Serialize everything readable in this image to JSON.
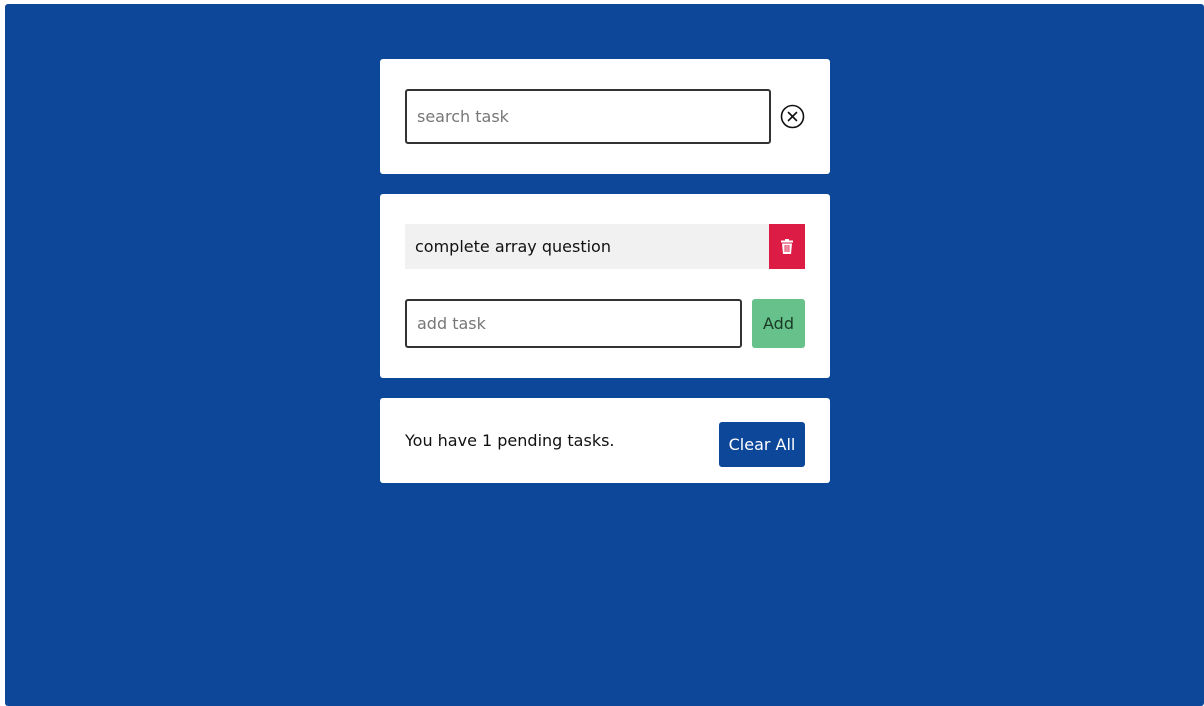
{
  "search": {
    "placeholder": "search task",
    "value": "",
    "clear_icon": "close-circle-icon"
  },
  "tasks": [
    {
      "text": "complete array question",
      "delete_icon": "trash-icon"
    }
  ],
  "add": {
    "placeholder": "add task",
    "button_label": "Add"
  },
  "footer": {
    "pending_text": "You have 1 pending tasks.",
    "clear_label": "Clear All"
  },
  "colors": {
    "background": "#0d4799",
    "delete": "#dc1c45",
    "add": "#66c18a",
    "clear_all": "#0d4799"
  }
}
